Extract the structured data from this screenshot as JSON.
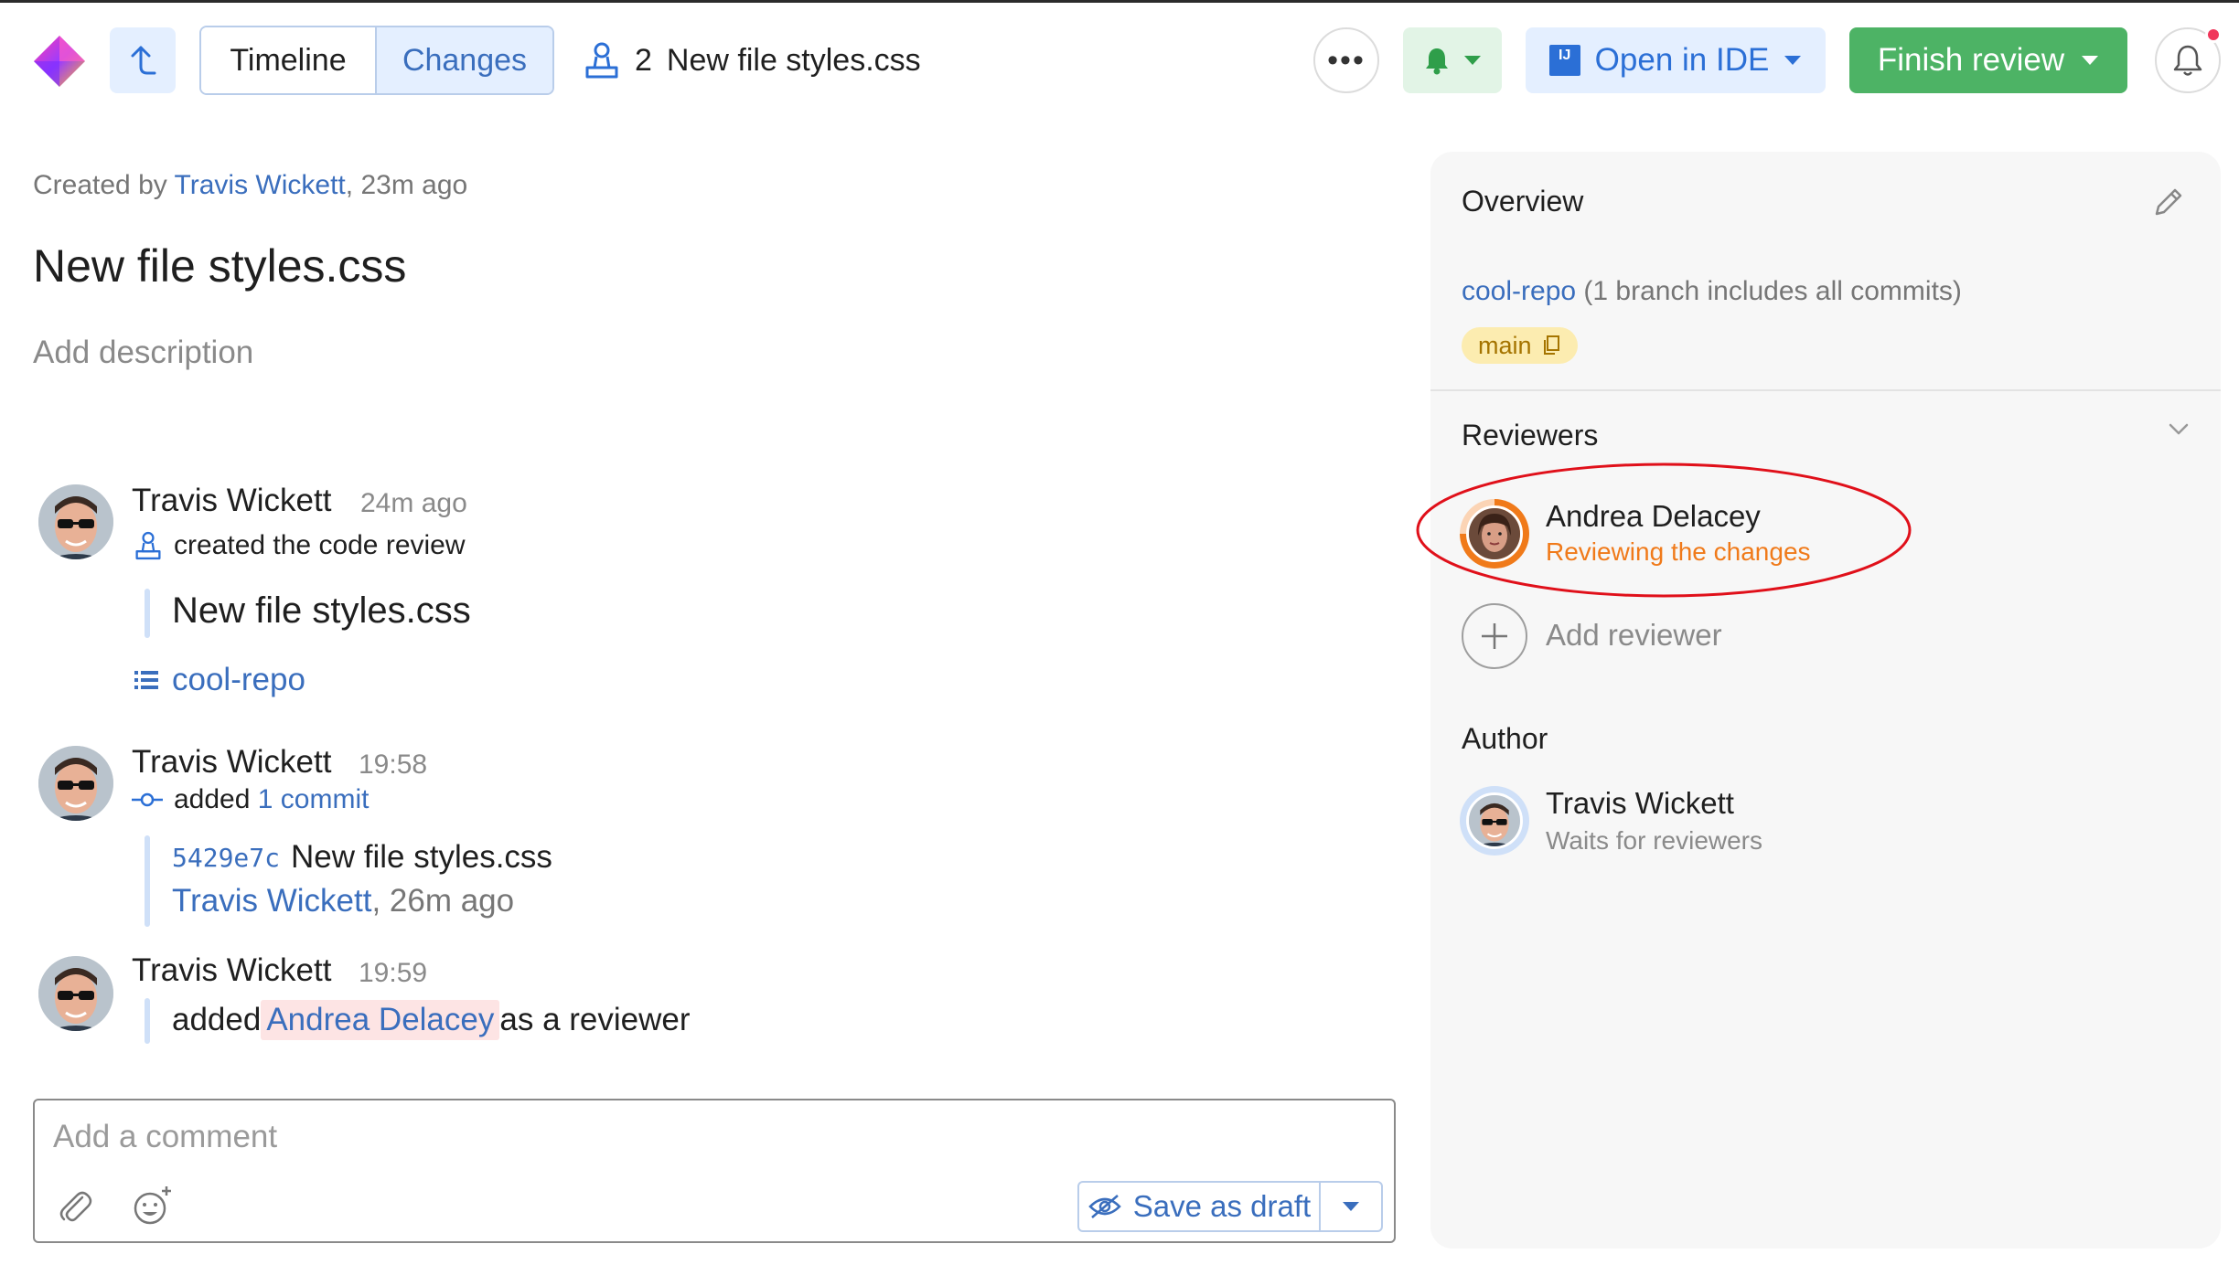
{
  "toolbar": {
    "tabs": [
      {
        "label": "Timeline",
        "active": false
      },
      {
        "label": "Changes",
        "active": true
      }
    ],
    "review_number": "2",
    "review_title": "New file styles.css",
    "open_ide_label": "Open in IDE",
    "finish_review_label": "Finish review"
  },
  "header": {
    "created_prefix": "Created by ",
    "created_author": "Travis Wickett",
    "created_suffix": ", 23m ago",
    "title": "New file styles.css",
    "description_placeholder": "Add description"
  },
  "timeline": [
    {
      "author": "Travis Wickett",
      "time": "24m ago",
      "action": "created the code review",
      "quote": "New file styles.css",
      "repo": "cool-repo"
    },
    {
      "author": "Travis Wickett",
      "time": "19:58",
      "action_prefix": "added ",
      "action_link": "1 commit",
      "commit_hash": "5429e7c",
      "commit_message": "New file styles.css",
      "commit_author": "Travis Wickett",
      "commit_time": ", 26m ago"
    },
    {
      "author": "Travis Wickett",
      "time": "19:59",
      "action_prefix": "added ",
      "mention": "Andrea Delacey",
      "action_suffix": " as a reviewer"
    }
  ],
  "comment": {
    "placeholder": "Add a comment",
    "save_draft_label": "Save as draft"
  },
  "overview": {
    "heading": "Overview",
    "repo": "cool-repo",
    "repo_note": " (1 branch includes all commits)",
    "branch": "main"
  },
  "reviewers": {
    "heading": "Reviewers",
    "items": [
      {
        "name": "Andrea Delacey",
        "status": "Reviewing the changes",
        "status_color": "#f07a1a"
      }
    ],
    "add_label": "Add reviewer"
  },
  "author": {
    "heading": "Author",
    "name": "Travis Wickett",
    "status": "Waits for reviewers"
  },
  "colors": {
    "accent": "#3a6ebd",
    "finish_green": "#4db365",
    "reviewing_orange": "#f07a1a",
    "highlight_red": "#e0101a"
  }
}
